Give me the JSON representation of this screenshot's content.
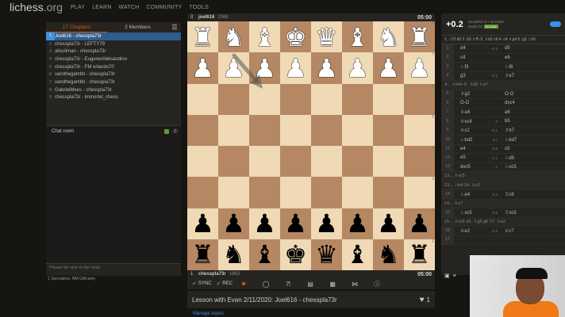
{
  "nav": {
    "logo_main": "lichess",
    "logo_tld": ".org",
    "items": [
      "PLAY",
      "LEARN",
      "WATCH",
      "COMMUNITY",
      "TOOLS"
    ]
  },
  "study": {
    "tabs": [
      "17 Chapters",
      "2 Members"
    ],
    "chapters": [
      {
        "num": "1",
        "title": "Joel616 - chesspla73r"
      },
      {
        "num": "2",
        "title": "chesspla73r - LEFTY78"
      },
      {
        "num": "3",
        "title": "alisuliman - chesspla73r"
      },
      {
        "num": "4",
        "title": "chesspla73r - EugeneAleksandrov"
      },
      {
        "num": "5",
        "title": "chesspla73r - FM orlando70"
      },
      {
        "num": "6",
        "title": "varothegambit - chesspla73r"
      },
      {
        "num": "7",
        "title": "varothegambit - chesspla73r"
      },
      {
        "num": "8",
        "title": "GabrielMees - chesspla73r"
      },
      {
        "num": "9",
        "title": "chesspla73r - immortel_chess"
      }
    ]
  },
  "chat": {
    "title": "Chat room",
    "placeholder": "Please be nice in the chat!",
    "spectators": "1 Spectators: NM GMcanty"
  },
  "players": {
    "top": {
      "num": "0",
      "name": "joel616",
      "rating": "2068",
      "clock": "05:00"
    },
    "bottom": {
      "num": "1",
      "name": "chesspla73r",
      "rating": "1963",
      "clock": "05:00"
    }
  },
  "board": {
    "ranks": [
      [
        "♜",
        "♞",
        "♝",
        "♚",
        "♛",
        "♝",
        "♞",
        "♜"
      ],
      [
        "♟",
        "♟",
        "♟",
        "♟",
        "♟",
        "♟",
        "♟",
        "♟"
      ],
      [
        "",
        "",
        "",
        "",
        "",
        "",
        "",
        ""
      ],
      [
        "",
        "",
        "",
        "",
        "",
        "",
        "",
        ""
      ],
      [
        "",
        "",
        "",
        "",
        "",
        "",
        "",
        ""
      ],
      [
        "",
        "",
        "",
        "",
        "",
        "",
        "",
        ""
      ],
      [
        "♟",
        "♟",
        "♟",
        "♟",
        "♟",
        "♟",
        "♟",
        "♟"
      ],
      [
        "♜",
        "♞",
        "♝",
        "♚",
        "♛",
        "♝",
        "♞",
        "♜"
      ]
    ],
    "colors": [
      "white",
      "white",
      "",
      "",
      "",
      "",
      "black",
      "black"
    ],
    "rank_labels": [
      "8",
      "7",
      "6",
      "5",
      "4",
      "3",
      "2",
      "1"
    ]
  },
  "toolbar": {
    "sync": "SYNC",
    "rec": "REC"
  },
  "lesson": {
    "title": "Lesson with Evan 2/11/2020: Joel616 - chesspla73r",
    "likes": "1",
    "manage": "Manage topics"
  },
  "engine": {
    "eval": "+0.2",
    "name": "Stockfish 11+ WASMX",
    "depth": "Depth 50",
    "cloud": "CLOUD",
    "pv": "1. ♘f3 d5 2. b3 ♗f5 3. ♗b2 c6 4. c4 ♗g4 5. g3 ♘h5"
  },
  "moves": [
    {
      "type": "row",
      "num": "1",
      "w": "d4",
      "ev": "+0.3",
      "b": "d5"
    },
    {
      "type": "row",
      "num": "2",
      "w": "c4",
      "ev": "",
      "b": "e6"
    },
    {
      "type": "row",
      "num": "3",
      "w": "♘f3",
      "ev": "",
      "b": "♘f6"
    },
    {
      "type": "row",
      "num": "4",
      "w": "g3",
      "ev": "+0.1",
      "b": "♗e7"
    },
    {
      "type": "sub",
      "text": "4... ♗b4+ 5. ♗d2 ♗e7"
    },
    {
      "type": "row",
      "num": "5",
      "w": "♗g2",
      "ev": "",
      "b": "O-O"
    },
    {
      "type": "row",
      "num": "6",
      "w": "O-O",
      "ev": "",
      "b": "dxc4"
    },
    {
      "type": "row",
      "num": "7",
      "w": "♕a4",
      "ev": "",
      "b": "a6"
    },
    {
      "type": "row",
      "num": "8",
      "w": "♕xc4",
      "ev": "0",
      "b": "b5"
    },
    {
      "type": "row",
      "num": "9",
      "w": "♕c2",
      "ev": "+0.1",
      "b": "♗b7"
    },
    {
      "type": "row",
      "num": "10",
      "w": "♘bd2",
      "ev": "0.7",
      "b": "♘bd7"
    },
    {
      "type": "row",
      "num": "11",
      "w": "e4",
      "ev": "-0.8",
      "b": "c5"
    },
    {
      "type": "row",
      "num": "12",
      "w": "e5",
      "ev": "-1.1",
      "b": "♘d5"
    },
    {
      "type": "row",
      "num": "13",
      "w": "dxc5",
      "ev": "-1",
      "b": "♘xc5"
    },
    {
      "type": "sub",
      "text": "13... ♗xc5"
    },
    {
      "type": "sub",
      "text": "13... ♘b4 14. ♕c3"
    },
    {
      "type": "row",
      "num": "14",
      "w": "♘e4",
      "ev": "-0.4",
      "b": "♖c8"
    },
    {
      "type": "sub",
      "text": "14... ♕e7"
    },
    {
      "type": "row",
      "num": "15",
      "w": "♘xc5",
      "ev": "-0.9",
      "b": "♖xc5"
    },
    {
      "type": "sub",
      "text": "15... ♗xc5 16. ♗g5 g6 17. ♕e2"
    },
    {
      "type": "row",
      "num": "16",
      "w": "♕e2",
      "ev": "-0.8",
      "b": "♕c7"
    },
    {
      "type": "row",
      "num": "17",
      "w": "",
      "ev": "",
      "b": ""
    }
  ]
}
